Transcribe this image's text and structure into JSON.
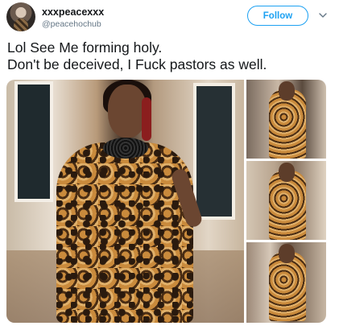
{
  "tweet": {
    "display_name": "xxxpeacexxx",
    "handle": "@peacehochub",
    "follow_label": "Follow",
    "text_lines": [
      "Lol See Me forming holy.",
      "Don't be deceived, I Fuck pastors as well."
    ]
  },
  "colors": {
    "accent": "#1da1f2",
    "text": "#14171a",
    "muted": "#657786"
  },
  "icons": {
    "chevron": "chevron-down-icon"
  }
}
